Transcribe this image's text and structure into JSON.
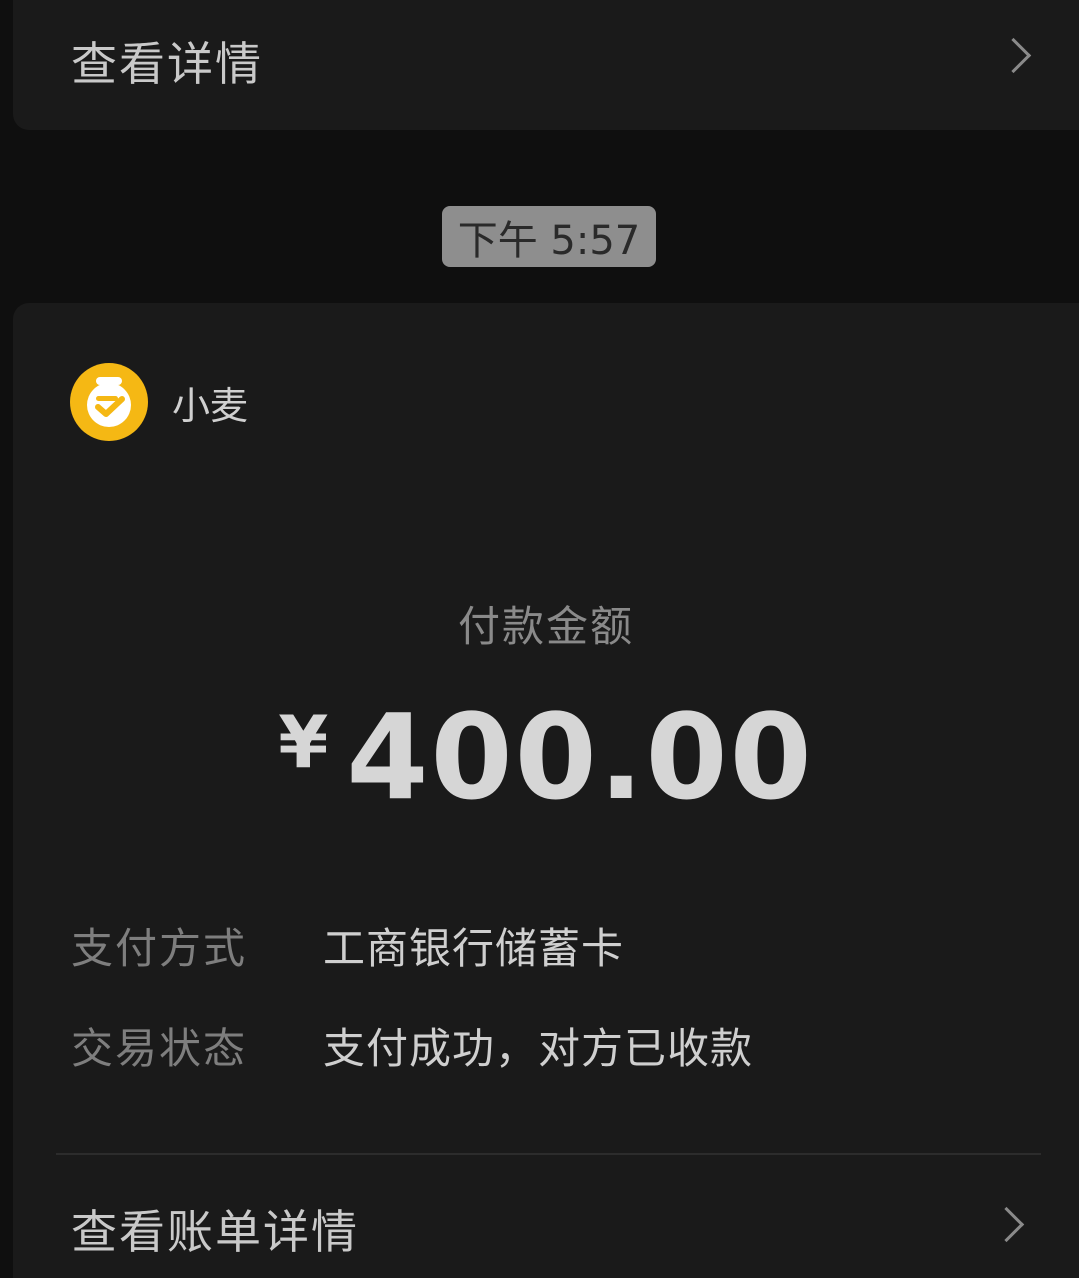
{
  "top_card": {
    "label": "查看详情"
  },
  "time_badge": "下午 5:57",
  "merchant": {
    "name": "小麦",
    "logo_color": "#f5b814"
  },
  "payment": {
    "amount_label": "付款金额",
    "currency": "¥",
    "amount": "400.00"
  },
  "details": [
    {
      "key": "支付方式",
      "value": "工商银行储蓄卡"
    },
    {
      "key": "交易状态",
      "value": "支付成功，对方已收款"
    }
  ],
  "bill_link": {
    "label": "查看账单详情"
  },
  "icons": {
    "chevron": "chevron-right-icon",
    "logo": "alarm-clock-logo-icon"
  }
}
